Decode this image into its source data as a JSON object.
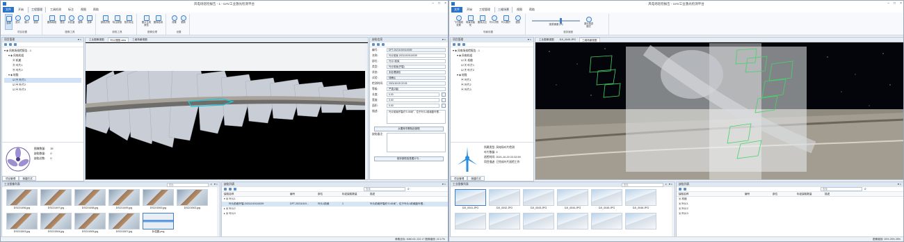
{
  "left": {
    "title": "风电场巡检报告 - 1 - UAV工业激光检测平台",
    "menus": [
      "文件",
      "开始",
      "工程管理",
      "工具检测",
      "标注",
      "视图",
      "帮助"
    ],
    "ribbon_groups": [
      {
        "label": "项目设置",
        "buttons": [
          "选择",
          "放大",
          "缩小",
          "漫游"
        ]
      },
      {
        "label": "图像工具",
        "buttons": [
          "图像增强",
          "叠加",
          "对比度",
          "旋转",
          "选择"
        ]
      },
      {
        "label": "缺陷工具",
        "buttons": [
          "缺陷识别",
          "标注缺陷",
          "矩形标注"
        ]
      },
      {
        "label": "图像处理",
        "buttons": [
          "图片生成报告",
          "图像检测"
        ]
      },
      {
        "label": "设置",
        "buttons": [
          "设置",
          "更新"
        ]
      }
    ],
    "project_panel": {
      "header": "项目管理",
      "tree": [
        "风电场巡检报告 - 1",
        "风电机组",
        "机舱",
        "叶片1",
        "叶片2",
        "轮毂",
        "叶片1",
        "叶片2",
        "叶片3"
      ],
      "info": [
        {
          "k": "图像数量:",
          "v": "39"
        },
        {
          "k": "缺陷数量:",
          "v": "0"
        },
        {
          "k": "缺陷总数:",
          "v": "0"
        }
      ],
      "tabs": [
        "项目管理",
        "快捷方式"
      ]
    },
    "view_tabs": [
      "工业图像视图",
      "叶片视图.view",
      "三维场景视图"
    ],
    "props": {
      "header": "缺陷信息",
      "rows": [
        {
          "k": "编号:",
          "v": "DFT-20211019110039",
          "t": "ro"
        },
        {
          "k": "名称:",
          "v": "叶片前缘-20211019110039",
          "t": "n"
        },
        {
          "k": "部位:",
          "v": "叶片1前缘",
          "t": "n"
        },
        {
          "k": "类型:",
          "v": "叶片前缘(开裂)",
          "t": "dd"
        },
        {
          "k": "状态:",
          "v": "未处理缺陷",
          "t": "dd"
        },
        {
          "k": "试验:",
          "v": "待确认",
          "t": "ro"
        },
        {
          "k": "检测时间:",
          "v": "2021/10/19 22:03",
          "t": "dd"
        },
        {
          "k": "等级:",
          "v": "严重(2级)",
          "t": "dd"
        },
        {
          "k": "长度:",
          "v": "0.00",
          "t": "n"
        },
        {
          "k": "宽度:",
          "v": "0.00",
          "t": "n"
        },
        {
          "k": "面积:",
          "v": "0.00",
          "t": "n"
        },
        {
          "k": "描述:",
          "v": "叶片前缘开裂约\"0.45米\"，位于叶片1前缘距叶根...",
          "t": "n"
        }
      ],
      "btn1": "从图库中删除此缺陷",
      "note_label": "缺陷备注:",
      "btn2": "保存缺陷信息图片与..."
    },
    "gallery": {
      "header": "工业图像列表",
      "search": "查找",
      "items": [
        "DSC01496.jpg",
        "DSC01497.jpg",
        "DSC01498.jpg",
        "DSC01499.jpg",
        "DSC01500.jpg",
        "DSC01502.jpg",
        "DSC01503.jpg",
        "DSC01504.jpg",
        "DSC01505.jpg",
        "DSC01507.jpg",
        "补偿图.png"
      ]
    },
    "defects": {
      "header": "缺陷列表",
      "search": "查找",
      "cols": [
        "缺陷名称",
        "编号",
        "部位",
        "标定缺陷数量",
        "描述"
      ],
      "rows": [
        {
          "name": "叶片1",
          "code": "",
          "part": "",
          "count": "",
          "desc": ""
        },
        {
          "name": "叶片前缘开裂-20211019110039",
          "code": "DFT-20211019...",
          "part": "叶片1前缘",
          "count": "1",
          "desc": "叶片前缘开裂约\"0.45米\"，位于叶片1前缘距叶根..."
        },
        {
          "name": "叶片2",
          "code": "",
          "part": "",
          "count": "",
          "desc": ""
        },
        {
          "name": "叶片3",
          "code": "",
          "part": "",
          "count": "",
          "desc": ""
        }
      ]
    },
    "status": "像素坐标: 3080.00, 222.17 图像缩放: 22.17%"
  },
  "right": {
    "title": "风电场巡检报告 - UAV工业激光检测平台",
    "menus": [
      "文件",
      "开始",
      "工程管理",
      "三维场景",
      "视图",
      "帮助"
    ],
    "ribbon_groups": [
      {
        "label": "场景设置",
        "buttons": [
          "飞行路线设置",
          "场景初始化",
          "图像点云",
          "叶片识别",
          "叶片展开",
          "漫游"
        ]
      },
      {
        "label": "漫游速度",
        "buttons": []
      },
      {
        "label": "",
        "buttons": [
          "退出漫游模式"
        ]
      }
    ],
    "slider_label": "漫游速度 (m)",
    "project_panel": {
      "header": "项目管理",
      "tree": [
        "风电场巡检报告 - 1",
        "风电机组",
        "机舱",
        "叶片1",
        "叶片2",
        "轮毂",
        "叶片1",
        "叶片2",
        "叶片3"
      ],
      "info": [
        {
          "k": "所属类型:",
          "v": "风电场叶片检测"
        },
        {
          "k": "叶片数量:",
          "v": "3"
        },
        {
          "k": "巡检时间:",
          "v": "2021-10-20 22:22:59"
        },
        {
          "k": "项目描述:",
          "v": "已完成叶片巡检工作"
        }
      ],
      "tabs": [
        "项目管理",
        "快捷方式"
      ]
    },
    "view_tabs": [
      "工业图像视图",
      "DJI_0045.JPG",
      "三维场景视图"
    ],
    "gallery": {
      "header": "工业图像列表",
      "search": "查找",
      "items": [
        "DJI_0041.JPG",
        "DJI_0042.JPG",
        "DJI_0043.JPG",
        "DJI_0044.JPG",
        "DJI_0045.JPG",
        "DJI_0046.JPG",
        "",
        "",
        "",
        "",
        "",
        ""
      ]
    },
    "defects": {
      "header": "缺陷列表",
      "search": "查找",
      "cols": [
        "缺陷名称",
        "编号",
        "部位",
        "标定缺陷数量",
        "描述"
      ],
      "rows": [
        {
          "name": "机舱"
        },
        {
          "name": "叶片1"
        },
        {
          "name": "叶片2"
        },
        {
          "name": "叶片3"
        }
      ]
    },
    "status": "图像缩放: 25%  25%  25%"
  }
}
